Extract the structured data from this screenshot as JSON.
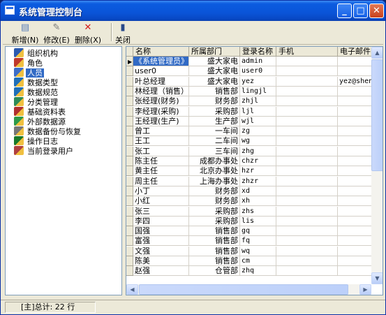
{
  "window": {
    "title": "系统管理控制台"
  },
  "toolbar": {
    "add_label": "新增(N)",
    "edit_label": "修改(E)",
    "delete_label": "删除(X)",
    "close_label": "关闭"
  },
  "tree": {
    "items": [
      {
        "label": "组织机构",
        "icon": "org-icon",
        "color": "#2a5ab0"
      },
      {
        "label": "角色",
        "icon": "role-icon",
        "color": "#c0392b"
      },
      {
        "label": "人员",
        "icon": "people-icon",
        "color": "#3c6ec8",
        "selected": true
      },
      {
        "label": "数据类型",
        "icon": "datatype-icon",
        "color": "#1f6fb8"
      },
      {
        "label": "数据规范",
        "icon": "dataspec-icon",
        "color": "#1f6fb8"
      },
      {
        "label": "分类管理",
        "icon": "category-icon",
        "color": "#2e8b57"
      },
      {
        "label": "基础资料表",
        "icon": "basedata-icon",
        "color": "#b03030"
      },
      {
        "label": "外部数据源",
        "icon": "external-data-icon",
        "color": "#2e9a48"
      },
      {
        "label": "数据备份与恢复",
        "icon": "backup-icon",
        "color": "#777777"
      },
      {
        "label": "操作日志",
        "icon": "log-icon",
        "color": "#1a7a2a"
      },
      {
        "label": "当前登录用户",
        "icon": "current-user-icon",
        "color": "#b04040"
      }
    ]
  },
  "grid": {
    "columns": [
      "名称",
      "所属部门",
      "登录名称",
      "手机",
      "电子邮件"
    ],
    "rows": [
      {
        "name": "《系统管理员》",
        "dept": "盛大家电",
        "login": "admin",
        "phone": "",
        "email": "",
        "current": true
      },
      {
        "name": "user0",
        "dept": "盛大家电",
        "login": "user0",
        "phone": "",
        "email": ""
      },
      {
        "name": "叶总经理",
        "dept": "盛大家电",
        "login": "yez",
        "phone": "",
        "email": "yez@shengd"
      },
      {
        "name": "林经理（销售）",
        "dept": "销售部",
        "login": "lingjl",
        "phone": "",
        "email": ""
      },
      {
        "name": "张经理(财务)",
        "dept": "财务部",
        "login": "zhjl",
        "phone": "",
        "email": ""
      },
      {
        "name": "李经理(采购)",
        "dept": "采购部",
        "login": "ljl",
        "phone": "",
        "email": ""
      },
      {
        "name": "王经理(生产)",
        "dept": "生产部",
        "login": "wjl",
        "phone": "",
        "email": ""
      },
      {
        "name": "曾工",
        "dept": "一车间",
        "login": "zg",
        "phone": "",
        "email": ""
      },
      {
        "name": "王工",
        "dept": "二车间",
        "login": "wg",
        "phone": "",
        "email": ""
      },
      {
        "name": "张工",
        "dept": "三车间",
        "login": "zhg",
        "phone": "",
        "email": ""
      },
      {
        "name": "陈主任",
        "dept": "成都办事处",
        "login": "chzr",
        "phone": "",
        "email": ""
      },
      {
        "name": "黄主任",
        "dept": "北京办事处",
        "login": "hzr",
        "phone": "",
        "email": ""
      },
      {
        "name": "周主任",
        "dept": "上海办事处",
        "login": "zhzr",
        "phone": "",
        "email": ""
      },
      {
        "name": "小丁",
        "dept": "财务部",
        "login": "xd",
        "phone": "",
        "email": ""
      },
      {
        "name": "小红",
        "dept": "财务部",
        "login": "xh",
        "phone": "",
        "email": ""
      },
      {
        "name": "张三",
        "dept": "采购部",
        "login": "zhs",
        "phone": "",
        "email": ""
      },
      {
        "name": "李四",
        "dept": "采购部",
        "login": "lis",
        "phone": "",
        "email": ""
      },
      {
        "name": "国强",
        "dept": "销售部",
        "login": "gq",
        "phone": "",
        "email": ""
      },
      {
        "name": "富强",
        "dept": "销售部",
        "login": "fq",
        "phone": "",
        "email": ""
      },
      {
        "name": "文强",
        "dept": "销售部",
        "login": "wq",
        "phone": "",
        "email": ""
      },
      {
        "name": "陈美",
        "dept": "销售部",
        "login": "cm",
        "phone": "",
        "email": ""
      },
      {
        "name": "赵强",
        "dept": "仓管部",
        "login": "zhq",
        "phone": "",
        "email": ""
      }
    ]
  },
  "status": {
    "text": "[主]总计: 22 行"
  },
  "colors": {
    "selection": "#316ac5",
    "titlebar": "#0a54d8",
    "chrome": "#ece9d8"
  }
}
